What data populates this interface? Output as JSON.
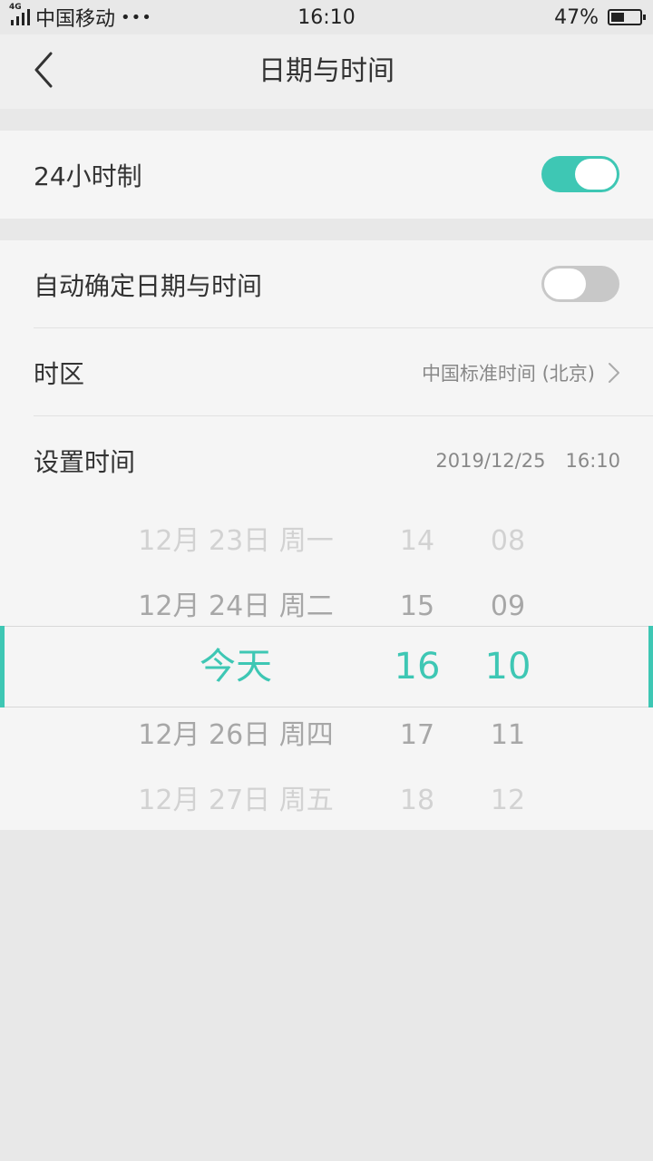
{
  "statusbar": {
    "network": "4G",
    "carrier": "中国移动",
    "dots": "•••",
    "time": "16:10",
    "battery_percent": "47%",
    "battery_level": 0.47
  },
  "navbar": {
    "title": "日期与时间",
    "back_icon": "chevron-left-icon"
  },
  "settings": {
    "hour24": {
      "label": "24小时制",
      "enabled": true
    },
    "auto_datetime": {
      "label": "自动确定日期与时间",
      "enabled": false
    },
    "timezone": {
      "label": "时区",
      "value": "中国标准时间 (北京)"
    },
    "set_time": {
      "label": "设置时间",
      "date": "2019/12/25",
      "time": "16:10"
    }
  },
  "picker": {
    "rows": [
      {
        "date": "12月 23日 周一",
        "hour": "14",
        "minute": "08"
      },
      {
        "date": "12月 24日 周二",
        "hour": "15",
        "minute": "09"
      },
      {
        "date": "今天",
        "hour": "16",
        "minute": "10"
      },
      {
        "date": "12月 26日 周四",
        "hour": "17",
        "minute": "11"
      },
      {
        "date": "12月 27日 周五",
        "hour": "18",
        "minute": "12"
      }
    ]
  },
  "colors": {
    "accent": "#3ec7b4",
    "toggle_off": "#c8c8c8",
    "background": "#e8e8e8",
    "card": "#f5f5f5"
  }
}
